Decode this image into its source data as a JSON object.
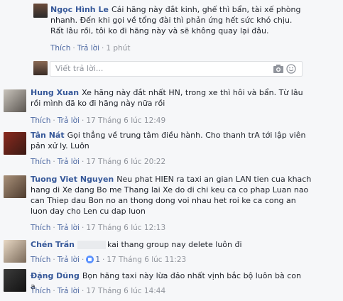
{
  "thread": {
    "top": {
      "author": "Ngọc Hình Le",
      "text": "Cái hãng này đắt kinh, ghế thì bẩn, tài xế phòng nhanh. Đến khi gọi về tổng đài thì phản ứng hết sức khó chịu. Rất lâu rồi, tôi ko đi hãng này và sẽ không quay lại đâu.",
      "like": "Thích",
      "reply": "Trả lời",
      "time": "1 phút"
    },
    "reply_input": {
      "placeholder": "Viết trả lời..."
    },
    "comments": [
      {
        "author": "Hung Xuan",
        "text": "Xe hãng này đắt nhất HN, trong xe thì hôi và bẩn. Từ lâu rồi mình đã ko đi hãng này nữa rồi",
        "like": "Thích",
        "reply": "Trả lời",
        "time": "17 Tháng 6 lúc 12:49"
      },
      {
        "author": "Tân Nát",
        "text": "Gọi thẳng về trung tâm điều hành. Cho thanh trA tới lập viên pản xử ly. Luôn",
        "like": "Thích",
        "reply": "Trả lời",
        "time": "17 Tháng 6 lúc 20:22"
      },
      {
        "author": "Tuong Viet Nguyen",
        "text": "Neu phat HIEN ra taxi an gian LAN tien cua khach hang di Xe dang Bo me Thang lai Xe do di chi keu ca co phap Luan nao can Thiep dau Bon no an thong dong voi nhau het roi ke ca cong an luon day cho Len cu dap luon",
        "like": "Thích",
        "reply": "Trả lời",
        "time": "17 Tháng 6 lúc 12:13"
      },
      {
        "author": "Chén Trần",
        "text": "kai thang group nay delete luôn đi",
        "like": "Thích",
        "reply": "Trả lời",
        "likes": "1",
        "time": "17 Tháng 6 lúc 11:23"
      },
      {
        "author": "Đặng Dũng",
        "text": "Bọn hãng taxi này lừa đảo nhất vịnh bắc bộ luôn bà con ạ",
        "like": "Thích",
        "reply": "Trả lời",
        "time": "17 Tháng 6 lúc 14:44"
      }
    ]
  }
}
